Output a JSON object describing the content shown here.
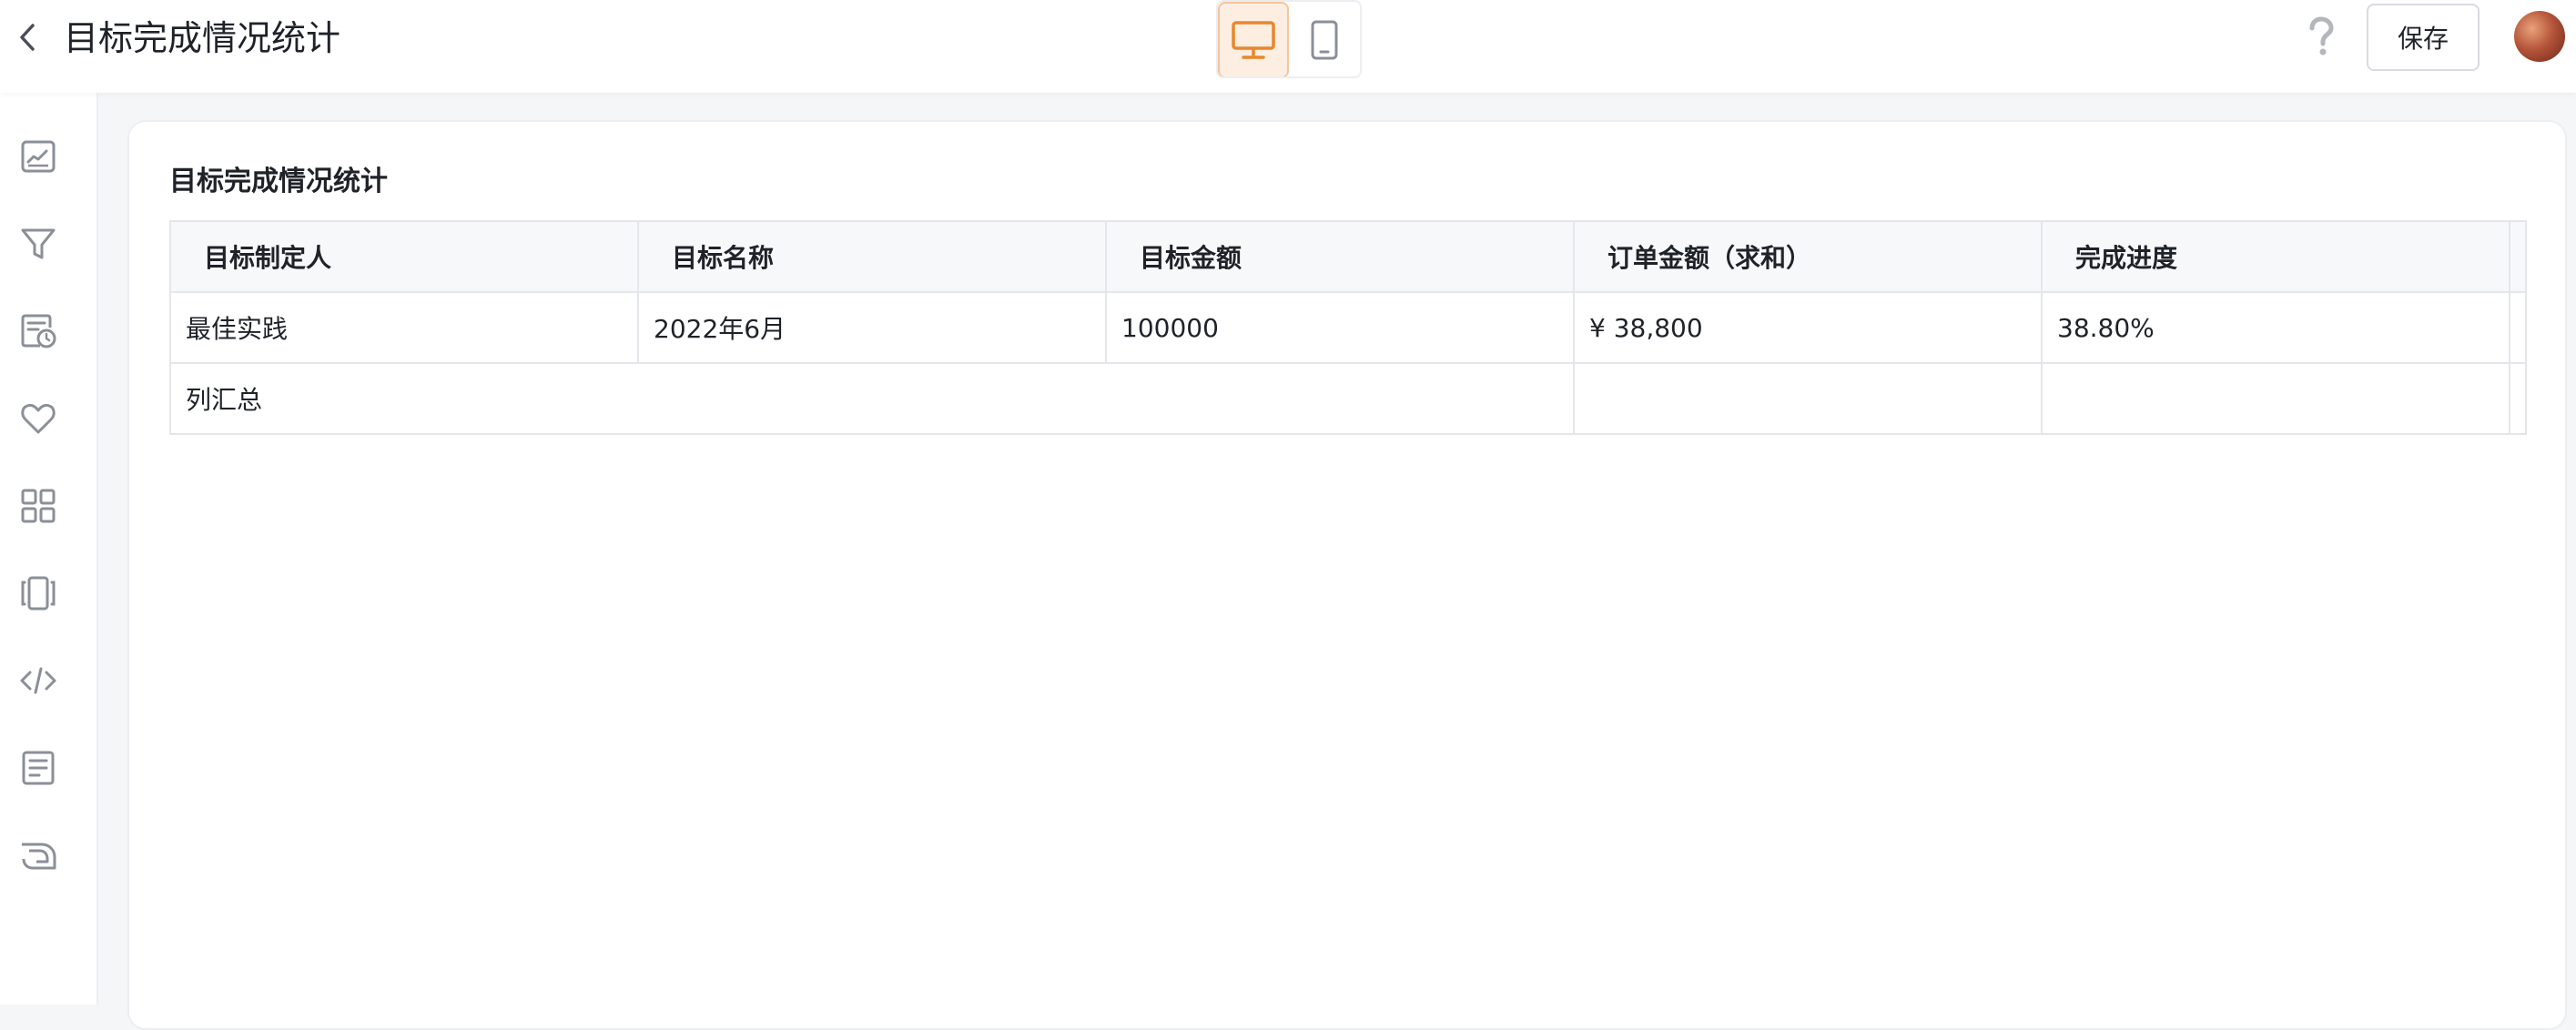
{
  "header": {
    "title": "目标完成情况统计",
    "save_label": "保存",
    "back_icon": "chevron-left-icon",
    "help_icon": "question-icon",
    "device_icons": [
      "desktop-monitor-icon",
      "tablet-icon"
    ],
    "accent_color": "#e8862d"
  },
  "sidebar": {
    "icons": [
      "line-chart-icon",
      "filter-icon",
      "scheduled-report-icon",
      "heart-icon",
      "grid-apps-icon",
      "carousel-icon",
      "code-icon",
      "document-icon",
      "custom-shape-icon"
    ]
  },
  "card": {
    "title": "目标完成情况统计",
    "table": {
      "columns": [
        "目标制定人",
        "目标名称",
        "目标金额",
        "订单金额（求和）",
        "完成进度"
      ],
      "row": {
        "owner": "最佳实践",
        "name": "2022年6月",
        "target_amount": "100000",
        "order_amount": "¥ 38,800",
        "progress": "38.80%"
      },
      "summary_label": "列汇总"
    }
  }
}
